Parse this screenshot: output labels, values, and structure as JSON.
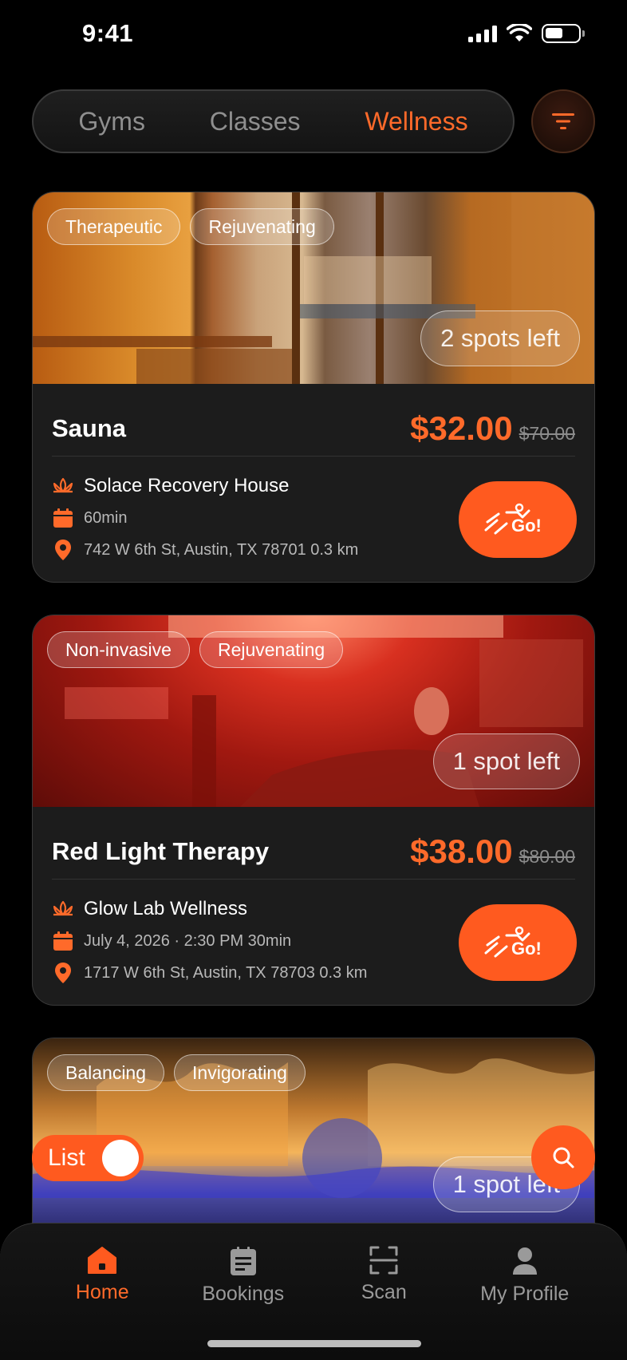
{
  "status_bar": {
    "time": "9:41"
  },
  "segments": [
    {
      "label": "Gyms"
    },
    {
      "label": "Classes"
    },
    {
      "label": "Wellness"
    }
  ],
  "accent_color": "#ff6a2a",
  "cards": [
    {
      "tags": [
        "Therapeutic",
        "Rejuvenating"
      ],
      "spots": "2 spots left",
      "title": "Sauna",
      "price": "$32.00",
      "old_price": "$70.00",
      "venue": "Solace Recovery House",
      "schedule": "60min",
      "address": "742 W 6th St, Austin, TX 78701  0.3 km"
    },
    {
      "tags": [
        "Non-invasive",
        "Rejuvenating"
      ],
      "spots": "1 spot left",
      "title": "Red Light Therapy",
      "price": "$38.00",
      "old_price": "$80.00",
      "venue": "Glow Lab Wellness",
      "schedule": "July 4, 2026 · 2:30 PM  30min",
      "address": "1717 W 6th St, Austin, TX 78703  0.3 km"
    },
    {
      "tags": [
        "Balancing",
        "Invigorating"
      ],
      "spots": "1 spot left"
    }
  ],
  "list_toggle": {
    "label": "List"
  },
  "tabs": [
    {
      "label": "Home"
    },
    {
      "label": "Bookings"
    },
    {
      "label": "Scan"
    },
    {
      "label": "My Profile"
    }
  ]
}
